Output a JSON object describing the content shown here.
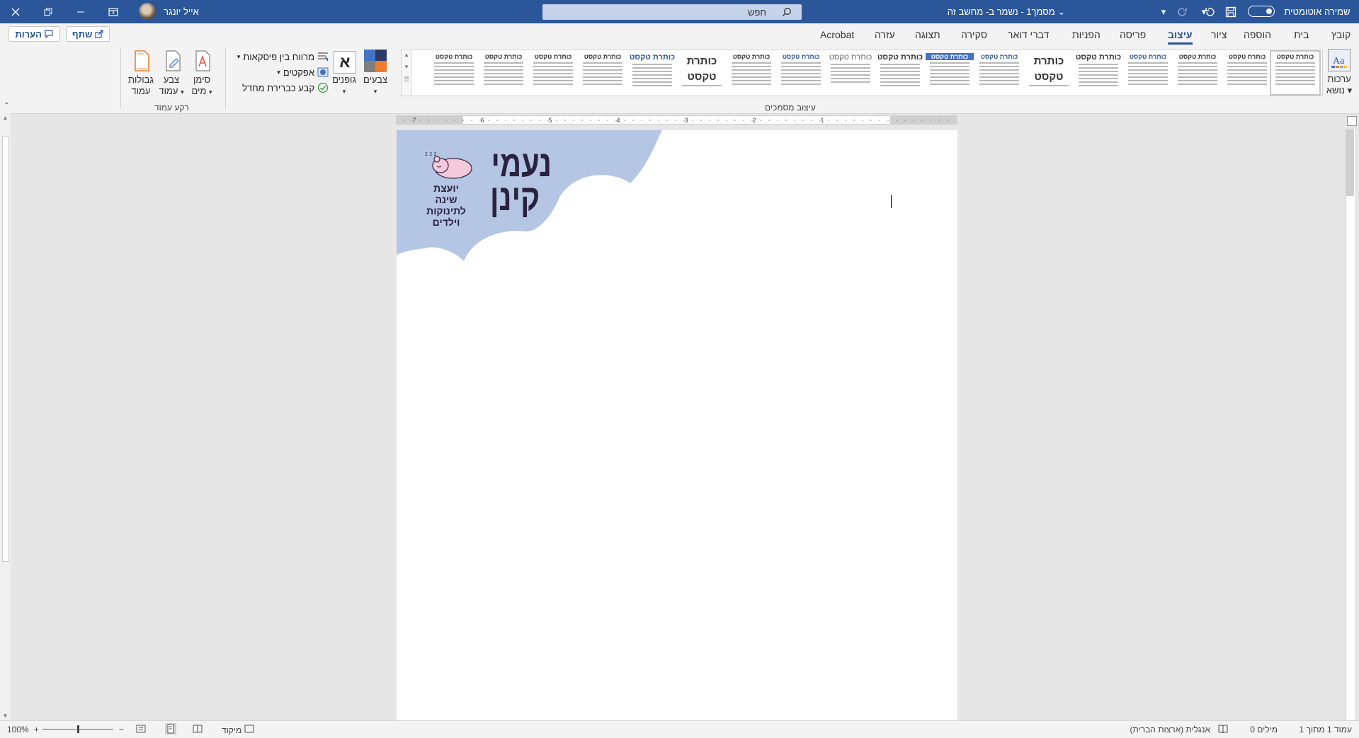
{
  "titlebar": {
    "autosave_label": "שמירה אוטומטית",
    "doc_title": "מסמך1  -  נשמר ב- מחשב זה",
    "title_chevron": "⌄",
    "search_placeholder": "חפש",
    "user_name": "אייל יונגר",
    "bg_color": "#2b579a"
  },
  "tabs": [
    {
      "label": "קובץ"
    },
    {
      "label": "בית"
    },
    {
      "label": "הוספה"
    },
    {
      "label": "ציור"
    },
    {
      "label": "עיצוב",
      "active": true
    },
    {
      "label": "פריסה"
    },
    {
      "label": "הפניות"
    },
    {
      "label": "דברי דואר"
    },
    {
      "label": "סקירה"
    },
    {
      "label": "תצוגה"
    },
    {
      "label": "עזרה"
    },
    {
      "label": "Acrobat"
    }
  ],
  "share": {
    "label": "שתף",
    "comments_label": "הערות"
  },
  "ribbon": {
    "themes_label_1": "ערכות",
    "themes_label_2": "נושא",
    "gallery_caption": "עיצוב מסמכים",
    "gallery_heading": "כותרת טקסט",
    "gallery_big_1": "כותרת",
    "gallery_big_2": "טקסט",
    "colors_label": "צבעים",
    "fonts_label": "גופנים",
    "fonts_glyph": "א",
    "spacing_label": "מרווח בין פיסקאות",
    "effects_label": "אפקטים",
    "default_label": "קבע כברירת מחדל",
    "watermark_1": "סימן",
    "watermark_2": "מים",
    "pagecolor_1": "צבע",
    "pagecolor_2": "עמוד",
    "borders_1": "גבולות",
    "borders_2": "עמוד",
    "background_group": "רקע עמוד"
  },
  "ruler_numbers": [
    "1",
    "2",
    "3",
    "4",
    "5",
    "6",
    "7"
  ],
  "logo": {
    "line1": "נעמי",
    "line2": "קינן",
    "tag1": "יועצת שינה",
    "tag2": "לתינוקות",
    "tag3": "וילדים",
    "zzz": "z z z",
    "cloud_color": "#b4c6e3"
  },
  "status": {
    "page": "עמוד 1 מתוך 1",
    "words": "0 מילים",
    "language": "אנגלית (ארצות הברית)",
    "focus": "מיקוד",
    "zoom": "100%",
    "zoom_minus": "−",
    "zoom_plus": "+",
    "zoom_level": 1.0
  }
}
